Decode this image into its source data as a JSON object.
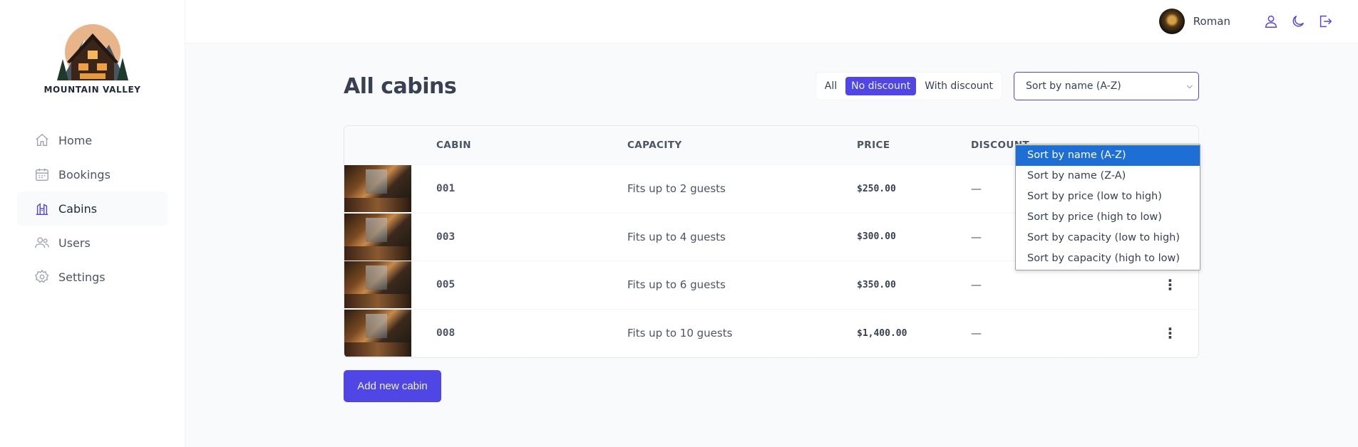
{
  "brand": {
    "name": "MOUNTAIN VALLEY"
  },
  "sidebar": {
    "items": [
      {
        "label": "Home",
        "icon": "home-icon",
        "active": false
      },
      {
        "label": "Bookings",
        "icon": "calendar-icon",
        "active": false
      },
      {
        "label": "Cabins",
        "icon": "cabins-icon",
        "active": true
      },
      {
        "label": "Users",
        "icon": "users-icon",
        "active": false
      },
      {
        "label": "Settings",
        "icon": "gear-icon",
        "active": false
      }
    ]
  },
  "header": {
    "user_name": "Roman",
    "icons": [
      "user-icon",
      "moon-icon",
      "logout-icon"
    ]
  },
  "page": {
    "title": "All cabins"
  },
  "filter": {
    "options": [
      "All",
      "No discount",
      "With discount"
    ],
    "active": "No discount"
  },
  "sort": {
    "selected": "Sort by name (A-Z)",
    "options": [
      "Sort by name (A-Z)",
      "Sort by name (Z-A)",
      "Sort by price (low to high)",
      "Sort by price (high to low)",
      "Sort by capacity (low to high)",
      "Sort by capacity (high to low)"
    ]
  },
  "table": {
    "headers": {
      "cabin": "CABIN",
      "capacity": "CAPACITY",
      "price": "PRICE",
      "discount": "DISCOUNT"
    },
    "rows": [
      {
        "cabin": "001",
        "capacity": "Fits up to 2 guests",
        "price": "$250.00",
        "discount": "—"
      },
      {
        "cabin": "003",
        "capacity": "Fits up to 4 guests",
        "price": "$300.00",
        "discount": "—"
      },
      {
        "cabin": "005",
        "capacity": "Fits up to 6 guests",
        "price": "$350.00",
        "discount": "—"
      },
      {
        "cabin": "008",
        "capacity": "Fits up to 10 guests",
        "price": "$1,400.00",
        "discount": "—"
      }
    ]
  },
  "actions": {
    "add_label": "Add new cabin"
  },
  "colors": {
    "accent": "#4f46e5",
    "dropdown_highlight": "#1d6fd6"
  }
}
